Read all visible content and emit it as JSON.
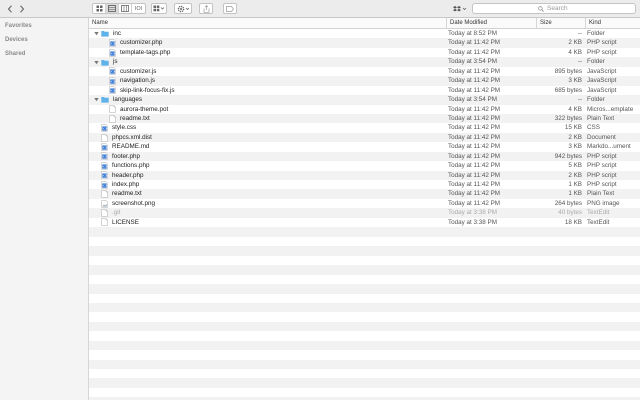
{
  "toolbar": {
    "search_placeholder": "Search",
    "view_cover_flow_label": "IOI"
  },
  "sidebar": {
    "sections": [
      "Favorites",
      "Devices",
      "Shared"
    ]
  },
  "columns": {
    "name": "Name",
    "date": "Date Modified",
    "size": "Size",
    "kind": "Kind"
  },
  "rows": [
    {
      "name": "inc",
      "date": "Today at 8:52 PM",
      "size": "--",
      "kind": "Folder",
      "depth": 0,
      "type": "folder",
      "expanded": true
    },
    {
      "name": "customizer.php",
      "date": "Today at 11:42 PM",
      "size": "2 KB",
      "kind": "PHP script",
      "depth": 1,
      "type": "code"
    },
    {
      "name": "template-tags.php",
      "date": "Today at 11:42 PM",
      "size": "4 KB",
      "kind": "PHP script",
      "depth": 1,
      "type": "code"
    },
    {
      "name": "js",
      "date": "Today at 3:54 PM",
      "size": "--",
      "kind": "Folder",
      "depth": 0,
      "type": "folder",
      "expanded": true
    },
    {
      "name": "customizer.js",
      "date": "Today at 11:42 PM",
      "size": "895 bytes",
      "kind": "JavaScript",
      "depth": 1,
      "type": "code"
    },
    {
      "name": "navigation.js",
      "date": "Today at 11:42 PM",
      "size": "3 KB",
      "kind": "JavaScript",
      "depth": 1,
      "type": "code"
    },
    {
      "name": "skip-link-focus-fix.js",
      "date": "Today at 11:42 PM",
      "size": "685 bytes",
      "kind": "JavaScript",
      "depth": 1,
      "type": "code"
    },
    {
      "name": "languages",
      "date": "Today at 3:54 PM",
      "size": "--",
      "kind": "Folder",
      "depth": 0,
      "type": "folder",
      "expanded": true
    },
    {
      "name": "aurora-theme.pot",
      "date": "Today at 11:42 PM",
      "size": "4 KB",
      "kind": "Micros...emplate",
      "depth": 1,
      "type": "doc"
    },
    {
      "name": "readme.txt",
      "date": "Today at 11:42 PM",
      "size": "322 bytes",
      "kind": "Plain Text",
      "depth": 1,
      "type": "doc"
    },
    {
      "name": "style.css",
      "date": "Today at 11:42 PM",
      "size": "15 KB",
      "kind": "CSS",
      "depth": 0,
      "type": "code"
    },
    {
      "name": "phpcs.xml.dist",
      "date": "Today at 11:42 PM",
      "size": "2 KB",
      "kind": "Document",
      "depth": 0,
      "type": "doc"
    },
    {
      "name": "README.md",
      "date": "Today at 11:42 PM",
      "size": "3 KB",
      "kind": "Markdo...ument",
      "depth": 0,
      "type": "code"
    },
    {
      "name": "footer.php",
      "date": "Today at 11:42 PM",
      "size": "942 bytes",
      "kind": "PHP script",
      "depth": 0,
      "type": "code"
    },
    {
      "name": "functions.php",
      "date": "Today at 11:42 PM",
      "size": "5 KB",
      "kind": "PHP script",
      "depth": 0,
      "type": "code"
    },
    {
      "name": "header.php",
      "date": "Today at 11:42 PM",
      "size": "2 KB",
      "kind": "PHP script",
      "depth": 0,
      "type": "code"
    },
    {
      "name": "index.php",
      "date": "Today at 11:42 PM",
      "size": "1 KB",
      "kind": "PHP script",
      "depth": 0,
      "type": "code"
    },
    {
      "name": "readme.txt",
      "date": "Today at 11:42 PM",
      "size": "1 KB",
      "kind": "Plain Text",
      "depth": 0,
      "type": "doc"
    },
    {
      "name": "screenshot.png",
      "date": "Today at 11:42 PM",
      "size": "264 bytes",
      "kind": "PNG image",
      "depth": 0,
      "type": "image"
    },
    {
      "name": ".git",
      "date": "Today at 3:38 PM",
      "size": "40 bytes",
      "kind": "TextEdit",
      "depth": 0,
      "type": "doc",
      "dim": true
    },
    {
      "name": "LICENSE",
      "date": "Today at 3:38 PM",
      "size": "18 KB",
      "kind": "TextEdit",
      "depth": 0,
      "type": "doc"
    }
  ],
  "colors": {
    "folder": "#5fb2e8",
    "code_icon": "#3a7bd5",
    "stripe": "#f2f2f2"
  }
}
